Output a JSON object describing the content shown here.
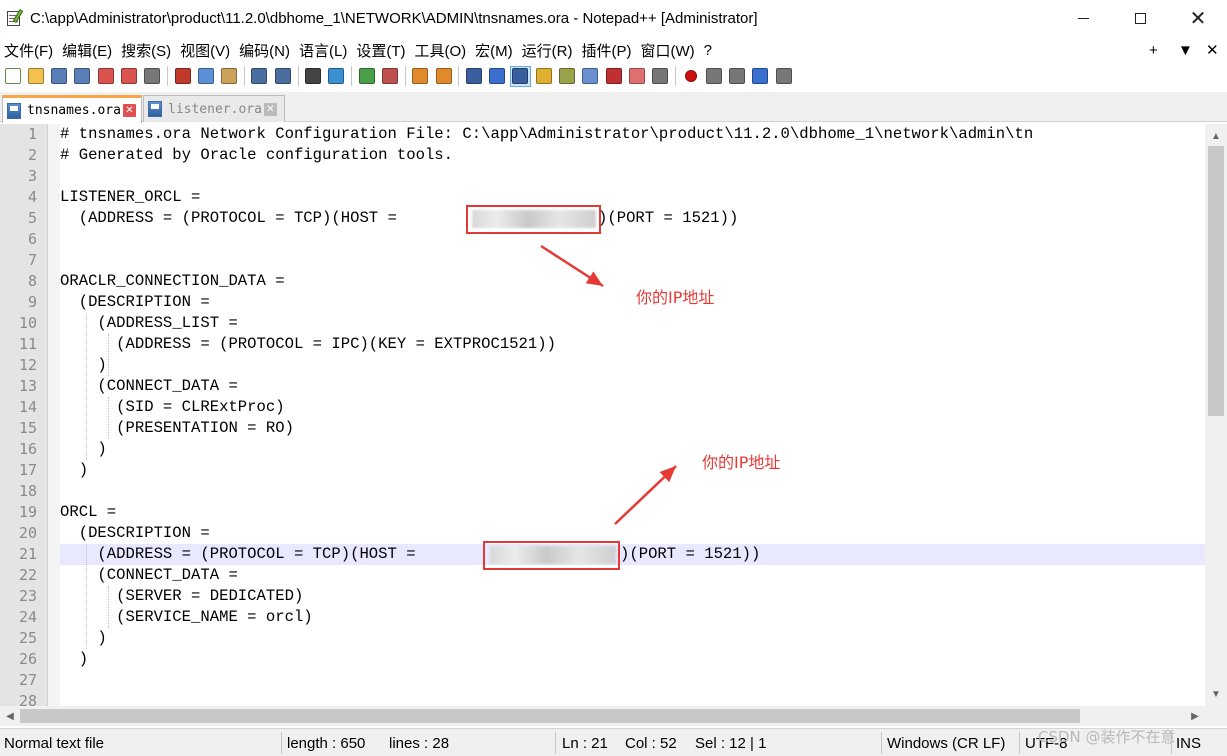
{
  "window": {
    "title": "C:\\app\\Administrator\\product\\11.2.0\\dbhome_1\\NETWORK\\ADMIN\\tnsnames.ora - Notepad++ [Administrator]",
    "minimize": "—",
    "maximize": "□",
    "close": "✕"
  },
  "menubar": {
    "items": [
      "文件(F)",
      "编辑(E)",
      "搜索(S)",
      "视图(V)",
      "编码(N)",
      "语言(L)",
      "设置(T)",
      "工具(O)",
      "宏(M)",
      "运行(R)",
      "插件(P)",
      "窗口(W)",
      "?"
    ],
    "right": [
      "+",
      "▼",
      "✕"
    ]
  },
  "toolbar": {
    "icons": [
      "new-file-icon",
      "open-file-icon",
      "save-icon",
      "save-all-icon",
      "close-icon",
      "close-all-icon",
      "print-icon",
      "sep",
      "cut-icon",
      "copy-icon",
      "paste-icon",
      "sep",
      "undo-icon",
      "redo-icon",
      "sep",
      "find-icon",
      "replace-icon",
      "sep",
      "zoom-in-icon",
      "zoom-out-icon",
      "sep",
      "sync-vertical-icon",
      "sync-horizontal-icon",
      "sep",
      "word-wrap-icon",
      "show-all-chars-icon",
      "indent-guide-icon",
      "udl-icon",
      "doc-map-icon",
      "function-list-icon",
      "folder-workspace-icon",
      "monitoring-icon",
      "eye-icon",
      "sep",
      "record-macro-icon",
      "stop-macro-icon",
      "play-macro-icon",
      "run-macro-multiple-icon",
      "save-macro-icon"
    ],
    "icon_colors": {
      "new-file-icon": "#ffffff",
      "open-file-icon": "#f2c14e",
      "save-icon": "#5a7fb8",
      "save-all-icon": "#5a7fb8",
      "close-icon": "#d9534f",
      "close-all-icon": "#d9534f",
      "print-icon": "#777777",
      "cut-icon": "#c0392b",
      "copy-icon": "#5b8fd6",
      "paste-icon": "#c9a15a",
      "undo-icon": "#4a6f9f",
      "redo-icon": "#4a6f9f",
      "find-icon": "#444444",
      "replace-icon": "#3a8fcf",
      "zoom-in-icon": "#4a9f4a",
      "zoom-out-icon": "#c05050",
      "sync-vertical-icon": "#e08a2a",
      "sync-horizontal-icon": "#e08a2a",
      "word-wrap-icon": "#3a5f9f",
      "show-all-chars-icon": "#3a6fcf",
      "indent-guide-icon": "#3a5f9f",
      "udl-icon": "#e0b030",
      "doc-map-icon": "#9aa24a",
      "function-list-icon": "#6a8fcf",
      "folder-workspace-icon": "#c03030",
      "monitoring-icon": "#e07070",
      "eye-icon": "#777777",
      "record-macro-icon": "#d01010",
      "stop-macro-icon": "#777777",
      "play-macro-icon": "#777777",
      "run-macro-multiple-icon": "#3a6fcf",
      "save-macro-icon": "#777777"
    }
  },
  "tabs": [
    {
      "label": "tnsnames.ora",
      "active": true
    },
    {
      "label": "listener.ora",
      "active": false
    }
  ],
  "editor": {
    "line_numbers": [
      "1",
      "2",
      "3",
      "4",
      "5",
      "6",
      "7",
      "8",
      "9",
      "10",
      "11",
      "12",
      "13",
      "14",
      "15",
      "16",
      "17",
      "18",
      "19",
      "20",
      "21",
      "22",
      "23",
      "24",
      "25",
      "26",
      "27",
      "28"
    ],
    "lines": [
      "# tnsnames.ora Network Configuration File: C:\\app\\Administrator\\product\\11.2.0\\dbhome_1\\network\\admin\\tn",
      "# Generated by Oracle configuration tools.",
      "",
      "LISTENER_ORCL =",
      "  (ADDRESS = (PROTOCOL = TCP)(HOST = ",
      "",
      "",
      "ORACLR_CONNECTION_DATA =",
      "  (DESCRIPTION =",
      "    (ADDRESS_LIST =",
      "      (ADDRESS = (PROTOCOL = IPC)(KEY = EXTPROC1521))",
      "    )",
      "    (CONNECT_DATA =",
      "      (SID = CLRExtProc)",
      "      (PRESENTATION = RO)",
      "    )",
      "  )",
      "",
      "ORCL =",
      "  (DESCRIPTION =",
      "    (ADDRESS = (PROTOCOL = TCP)(HOST = ",
      "    (CONNECT_DATA =",
      "      (SERVER = DEDICATED)",
      "      (SERVICE_NAME = orcl)",
      "    )",
      "  )",
      "",
      ""
    ],
    "line5_tail": ")(PORT = 1521))",
    "line21_tail": ")(PORT = 1521))",
    "current_line": 21,
    "annotation_1": "你的IP地址",
    "annotation_2": "你的IP地址",
    "annotation_color": "#e53935"
  },
  "statusbar": {
    "file_type": "Normal text file",
    "length": "length : 650",
    "lines": "lines : 28",
    "ln": "Ln : 21",
    "col": "Col : 52",
    "sel": "Sel : 12 | 1",
    "eol": "Windows (CR LF)",
    "encoding": "UTF-8",
    "mode": "INS"
  },
  "watermark": "CSDN @装作不在意"
}
